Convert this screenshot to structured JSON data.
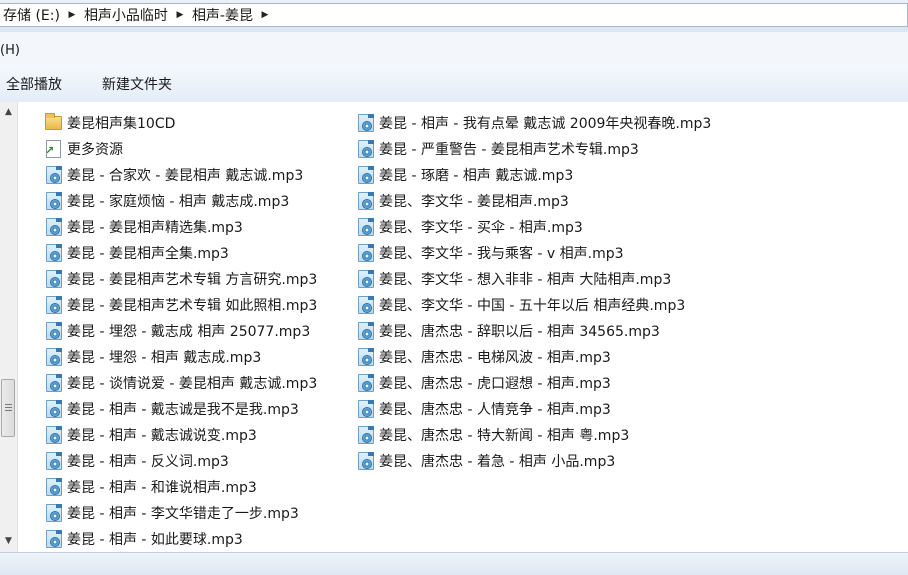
{
  "address": {
    "crumbs": [
      "存储 (E:)",
      "相声小品临时",
      "相声-姜昆"
    ]
  },
  "menubar": {
    "item": "(H)"
  },
  "toolbar": {
    "play_all": "全部播放",
    "new_folder": "新建文件夹"
  },
  "files": {
    "col1": [
      {
        "name": "姜昆相声集10CD",
        "icon": "folder-icon"
      },
      {
        "name": "更多资源",
        "icon": "shortcut-icon"
      },
      {
        "name": "姜昆 - 合家欢 - 姜昆相声 戴志诚.mp3",
        "icon": "mp3-file-icon"
      },
      {
        "name": "姜昆 - 家庭烦恼 - 相声 戴志成.mp3",
        "icon": "mp3-file-icon"
      },
      {
        "name": "姜昆 - 姜昆相声精选集.mp3",
        "icon": "mp3-file-icon"
      },
      {
        "name": "姜昆 - 姜昆相声全集.mp3",
        "icon": "mp3-file-icon"
      },
      {
        "name": "姜昆 - 姜昆相声艺术专辑 方言研究.mp3",
        "icon": "mp3-file-icon"
      },
      {
        "name": "姜昆 - 姜昆相声艺术专辑 如此照相.mp3",
        "icon": "mp3-file-icon"
      },
      {
        "name": "姜昆 - 埋怨 - 戴志成 相声 25077.mp3",
        "icon": "mp3-file-icon"
      },
      {
        "name": "姜昆 - 埋怨 - 相声 戴志成.mp3",
        "icon": "mp3-file-icon"
      },
      {
        "name": "姜昆 - 谈情说爱 - 姜昆相声 戴志诚.mp3",
        "icon": "mp3-file-icon"
      },
      {
        "name": "姜昆 - 相声 - 戴志诚是我不是我.mp3",
        "icon": "mp3-file-icon"
      },
      {
        "name": "姜昆 - 相声 - 戴志诚说变.mp3",
        "icon": "mp3-file-icon"
      },
      {
        "name": "姜昆 - 相声 - 反义词.mp3",
        "icon": "mp3-file-icon"
      },
      {
        "name": "姜昆 - 相声 - 和谁说相声.mp3",
        "icon": "mp3-file-icon"
      },
      {
        "name": "姜昆 - 相声 - 李文华错走了一步.mp3",
        "icon": "mp3-file-icon"
      },
      {
        "name": "姜昆 - 相声 - 如此要球.mp3",
        "icon": "mp3-file-icon"
      }
    ],
    "col2": [
      {
        "name": "姜昆 - 相声 - 我有点晕 戴志诚 2009年央视春晚.mp3",
        "icon": "mp3-file-icon"
      },
      {
        "name": "姜昆 - 严重警告 - 姜昆相声艺术专辑.mp3",
        "icon": "mp3-file-icon"
      },
      {
        "name": "姜昆 - 琢磨 - 相声 戴志诚.mp3",
        "icon": "mp3-file-icon"
      },
      {
        "name": "姜昆、李文华 - 姜昆相声.mp3",
        "icon": "mp3-file-icon"
      },
      {
        "name": "姜昆、李文华 - 买伞 - 相声.mp3",
        "icon": "mp3-file-icon"
      },
      {
        "name": "姜昆、李文华 - 我与乘客 - v 相声.mp3",
        "icon": "mp3-file-icon"
      },
      {
        "name": "姜昆、李文华 - 想入非非 - 相声 大陆相声.mp3",
        "icon": "mp3-file-icon"
      },
      {
        "name": "姜昆、李文华 - 中国 - 五十年以后 相声经典.mp3",
        "icon": "mp3-file-icon"
      },
      {
        "name": "姜昆、唐杰忠 - 辞职以后 - 相声 34565.mp3",
        "icon": "mp3-file-icon"
      },
      {
        "name": "姜昆、唐杰忠 - 电梯风波 - 相声.mp3",
        "icon": "mp3-file-icon"
      },
      {
        "name": "姜昆、唐杰忠 - 虎口遐想 - 相声.mp3",
        "icon": "mp3-file-icon"
      },
      {
        "name": "姜昆、唐杰忠 - 人情竞争 - 相声.mp3",
        "icon": "mp3-file-icon"
      },
      {
        "name": "姜昆、唐杰忠 - 特大新闻 - 相声 粤.mp3",
        "icon": "mp3-file-icon"
      },
      {
        "name": "姜昆、唐杰忠 - 着急 - 相声 小品.mp3",
        "icon": "mp3-file-icon"
      }
    ]
  }
}
